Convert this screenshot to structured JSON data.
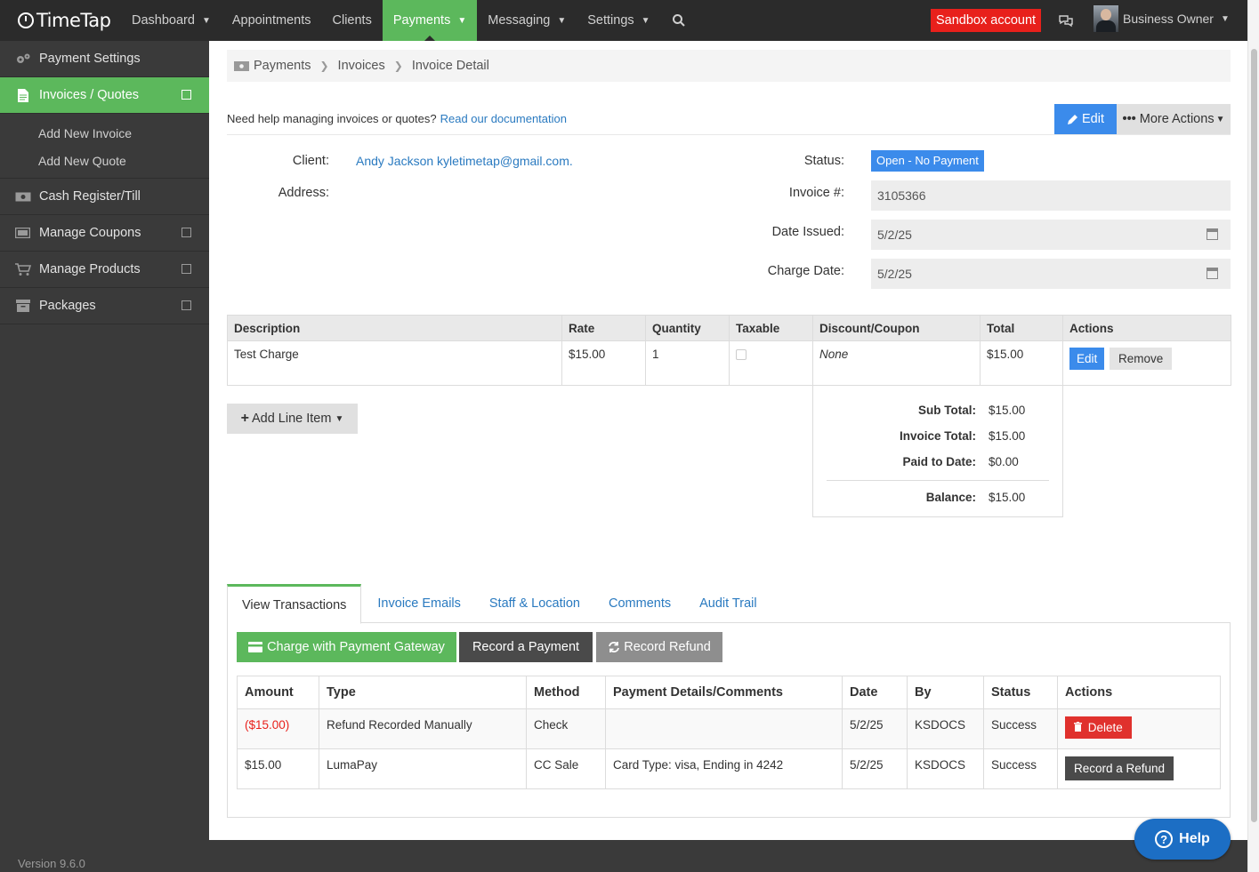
{
  "app": {
    "logo": "TimeTap"
  },
  "topnav": {
    "items": [
      {
        "label": "Dashboard",
        "caret": true
      },
      {
        "label": "Appointments",
        "caret": false
      },
      {
        "label": "Clients",
        "caret": false
      },
      {
        "label": "Payments",
        "caret": true,
        "active": true
      },
      {
        "label": "Messaging",
        "caret": true
      },
      {
        "label": "Settings",
        "caret": true
      }
    ],
    "sandbox": "Sandbox account",
    "user_name": "Business Owner"
  },
  "sidebar": {
    "items": [
      {
        "label": "Payment Settings",
        "icon": "gears-icon"
      },
      {
        "label": "Invoices / Quotes",
        "icon": "document-icon",
        "active": true
      },
      {
        "label": "Cash Register/Till",
        "icon": "cash-icon"
      },
      {
        "label": "Manage Coupons",
        "icon": "ticket-icon"
      },
      {
        "label": "Manage Products",
        "icon": "cart-icon"
      },
      {
        "label": "Packages",
        "icon": "archive-icon"
      }
    ],
    "sub_items": [
      "Add New Invoice",
      "Add New Quote"
    ],
    "version": "Version 9.6.0"
  },
  "breadcrumb": [
    "Payments",
    "Invoices",
    "Invoice Detail"
  ],
  "help_text": "Need help managing invoices or quotes?",
  "help_link": "Read our documentation",
  "buttons": {
    "edit": "Edit",
    "more_actions": "More Actions"
  },
  "invoice": {
    "client_label": "Client:",
    "client_value": "Andy Jackson kyletimetap@gmail.com.",
    "address_label": "Address:",
    "status_label": "Status:",
    "status_value": "Open - No Payment",
    "invoice_no_label": "Invoice #:",
    "invoice_no": "3105366",
    "date_issued_label": "Date Issued:",
    "date_issued": "5/2/25",
    "charge_date_label": "Charge Date:",
    "charge_date": "5/2/25"
  },
  "line_items": {
    "headers": [
      "Description",
      "Rate",
      "Quantity",
      "Taxable",
      "Discount/Coupon",
      "Total",
      "Actions"
    ],
    "rows": [
      {
        "description": "Test Charge",
        "rate": "$15.00",
        "quantity": "1",
        "taxable": false,
        "discount": "None",
        "total": "$15.00",
        "edit": "Edit",
        "remove": "Remove"
      }
    ],
    "add_line": "Add Line Item"
  },
  "totals": {
    "sub_total_label": "Sub Total:",
    "sub_total": "$15.00",
    "invoice_total_label": "Invoice Total:",
    "invoice_total": "$15.00",
    "paid_label": "Paid to Date:",
    "paid": "$0.00",
    "balance_label": "Balance:",
    "balance": "$15.00"
  },
  "tabs": [
    "View Transactions",
    "Invoice Emails",
    "Staff & Location",
    "Comments",
    "Audit Trail"
  ],
  "transactions": {
    "charge_button": "Charge with Payment Gateway",
    "record_payment": "Record a Payment",
    "record_refund": "Record Refund",
    "headers": [
      "Amount",
      "Type",
      "Method",
      "Payment Details/Comments",
      "Date",
      "By",
      "Status",
      "Actions"
    ],
    "rows": [
      {
        "amount": "($15.00)",
        "type": "Refund Recorded Manually",
        "method": "Check",
        "details": "",
        "date": "5/2/25",
        "by": "KSDOCS",
        "status": "Success",
        "action": "Delete"
      },
      {
        "amount": "$15.00",
        "type": "LumaPay",
        "method": "CC Sale",
        "details": "Card Type: visa, Ending in 4242",
        "date": "5/2/25",
        "by": "KSDOCS",
        "status": "Success",
        "action": "Record a Refund"
      }
    ]
  },
  "help_button": "Help",
  "colors": {
    "accent_green": "#5cb85c",
    "primary_blue": "#3b8beb",
    "danger_red": "#e0312d",
    "nav_bg": "#2b2b2b"
  }
}
